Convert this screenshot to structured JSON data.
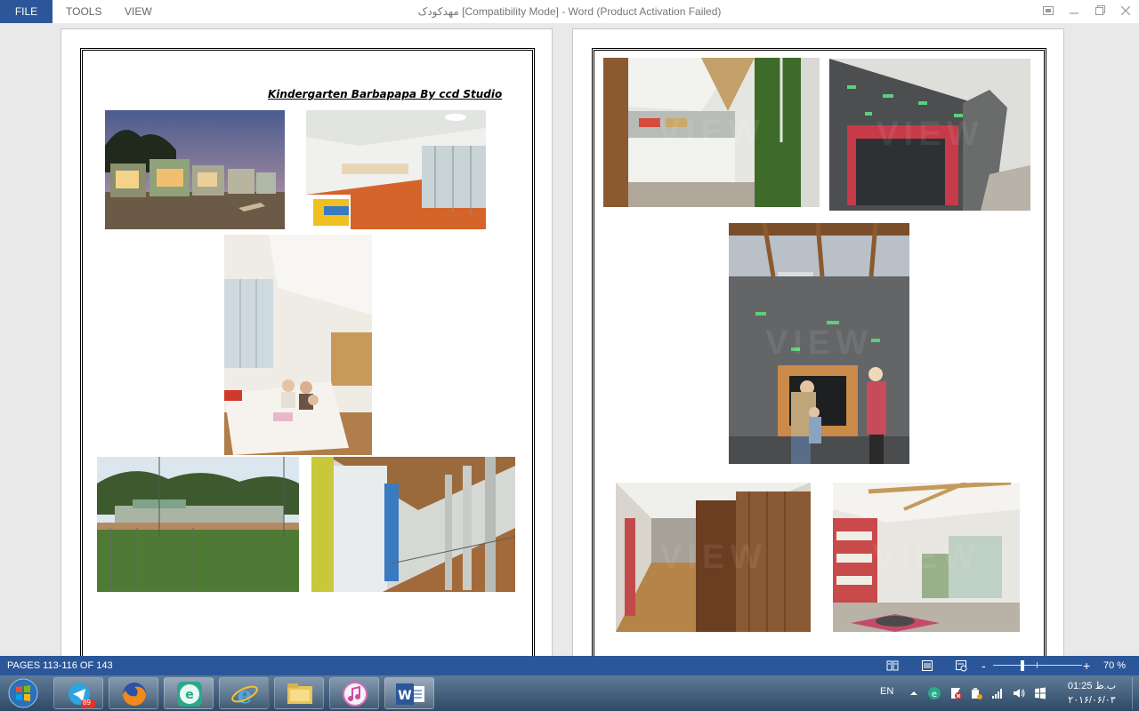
{
  "menu": {
    "file": "FILE",
    "tools": "TOOLS",
    "view": "VIEW"
  },
  "window": {
    "title": "مهدکودک [Compatibility Mode] - Word (Product Activation Failed)"
  },
  "document": {
    "heading": "Kindergarten Barbapapa By ccd Studio",
    "watermark_text": "VIEW"
  },
  "status": {
    "pages": "PAGES 113-116 OF 143",
    "zoom_minus": "-",
    "zoom_plus": "+",
    "zoom_level": "70 %"
  },
  "taskbar": {
    "telegram_badge": "89",
    "language": "EN",
    "clock_time": "01:25 ب.ظ",
    "clock_date": "۲۰۱۶/۰۶/۰۳"
  },
  "colors": {
    "accent": "#2b579a",
    "taskbar": "#3f5b78"
  }
}
